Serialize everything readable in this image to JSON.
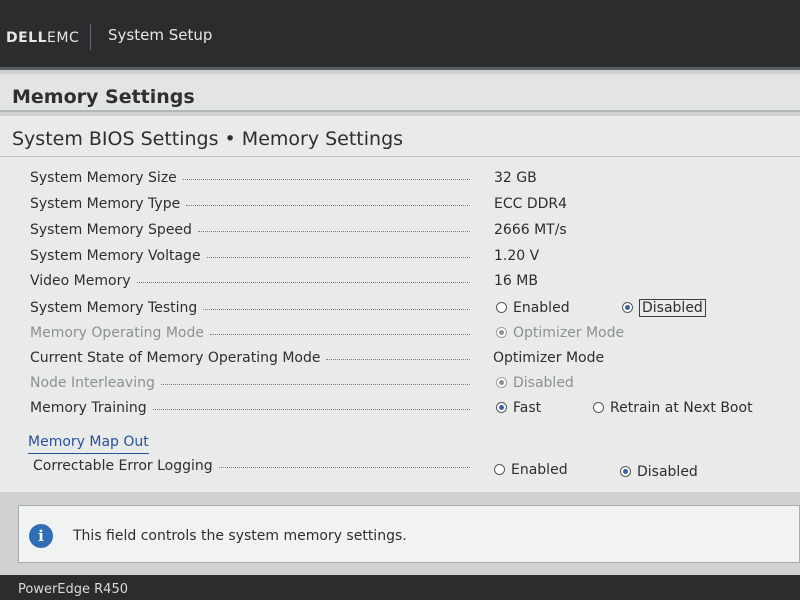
{
  "header": {
    "logo_dell": "DELL",
    "logo_emc": "EMC",
    "app_title": "System Setup"
  },
  "page_title": "Memory Settings",
  "section_title": "System BIOS Settings • Memory Settings",
  "settings": {
    "memory_size": {
      "label": "System Memory Size",
      "value": "32 GB"
    },
    "memory_type": {
      "label": "System Memory Type",
      "value": "ECC DDR4"
    },
    "memory_speed": {
      "label": "System Memory Speed",
      "value": "2666 MT/s"
    },
    "memory_voltage": {
      "label": "System Memory Voltage",
      "value": "1.20 V"
    },
    "video_memory": {
      "label": "Video Memory",
      "value": "16 MB"
    },
    "memory_testing": {
      "label": "System Memory Testing",
      "options": [
        "Enabled",
        "Disabled"
      ],
      "selected": "Disabled"
    },
    "operating_mode": {
      "label": "Memory Operating Mode",
      "option": "Optimizer Mode"
    },
    "current_state": {
      "label": "Current State of Memory Operating Mode",
      "value": "Optimizer Mode"
    },
    "node_interleaving": {
      "label": "Node Interleaving",
      "option": "Disabled"
    },
    "memory_training": {
      "label": "Memory Training",
      "options": [
        "Fast",
        "Retrain at Next Boot"
      ],
      "selected": "Fast"
    },
    "memory_map_out": {
      "label": "Memory Map Out"
    },
    "error_logging": {
      "label": "Correctable Error Logging",
      "options": [
        "Enabled",
        "Disabled"
      ],
      "selected": "Disabled"
    }
  },
  "help_text": "This field controls the system memory settings.",
  "footer": {
    "model": "PowerEdge R450"
  },
  "icons": {
    "info": "info-icon"
  },
  "colors": {
    "link": "#2a4f9d",
    "radio_selected": "#3a5fa8",
    "header_bg": "#2b2c2e"
  }
}
